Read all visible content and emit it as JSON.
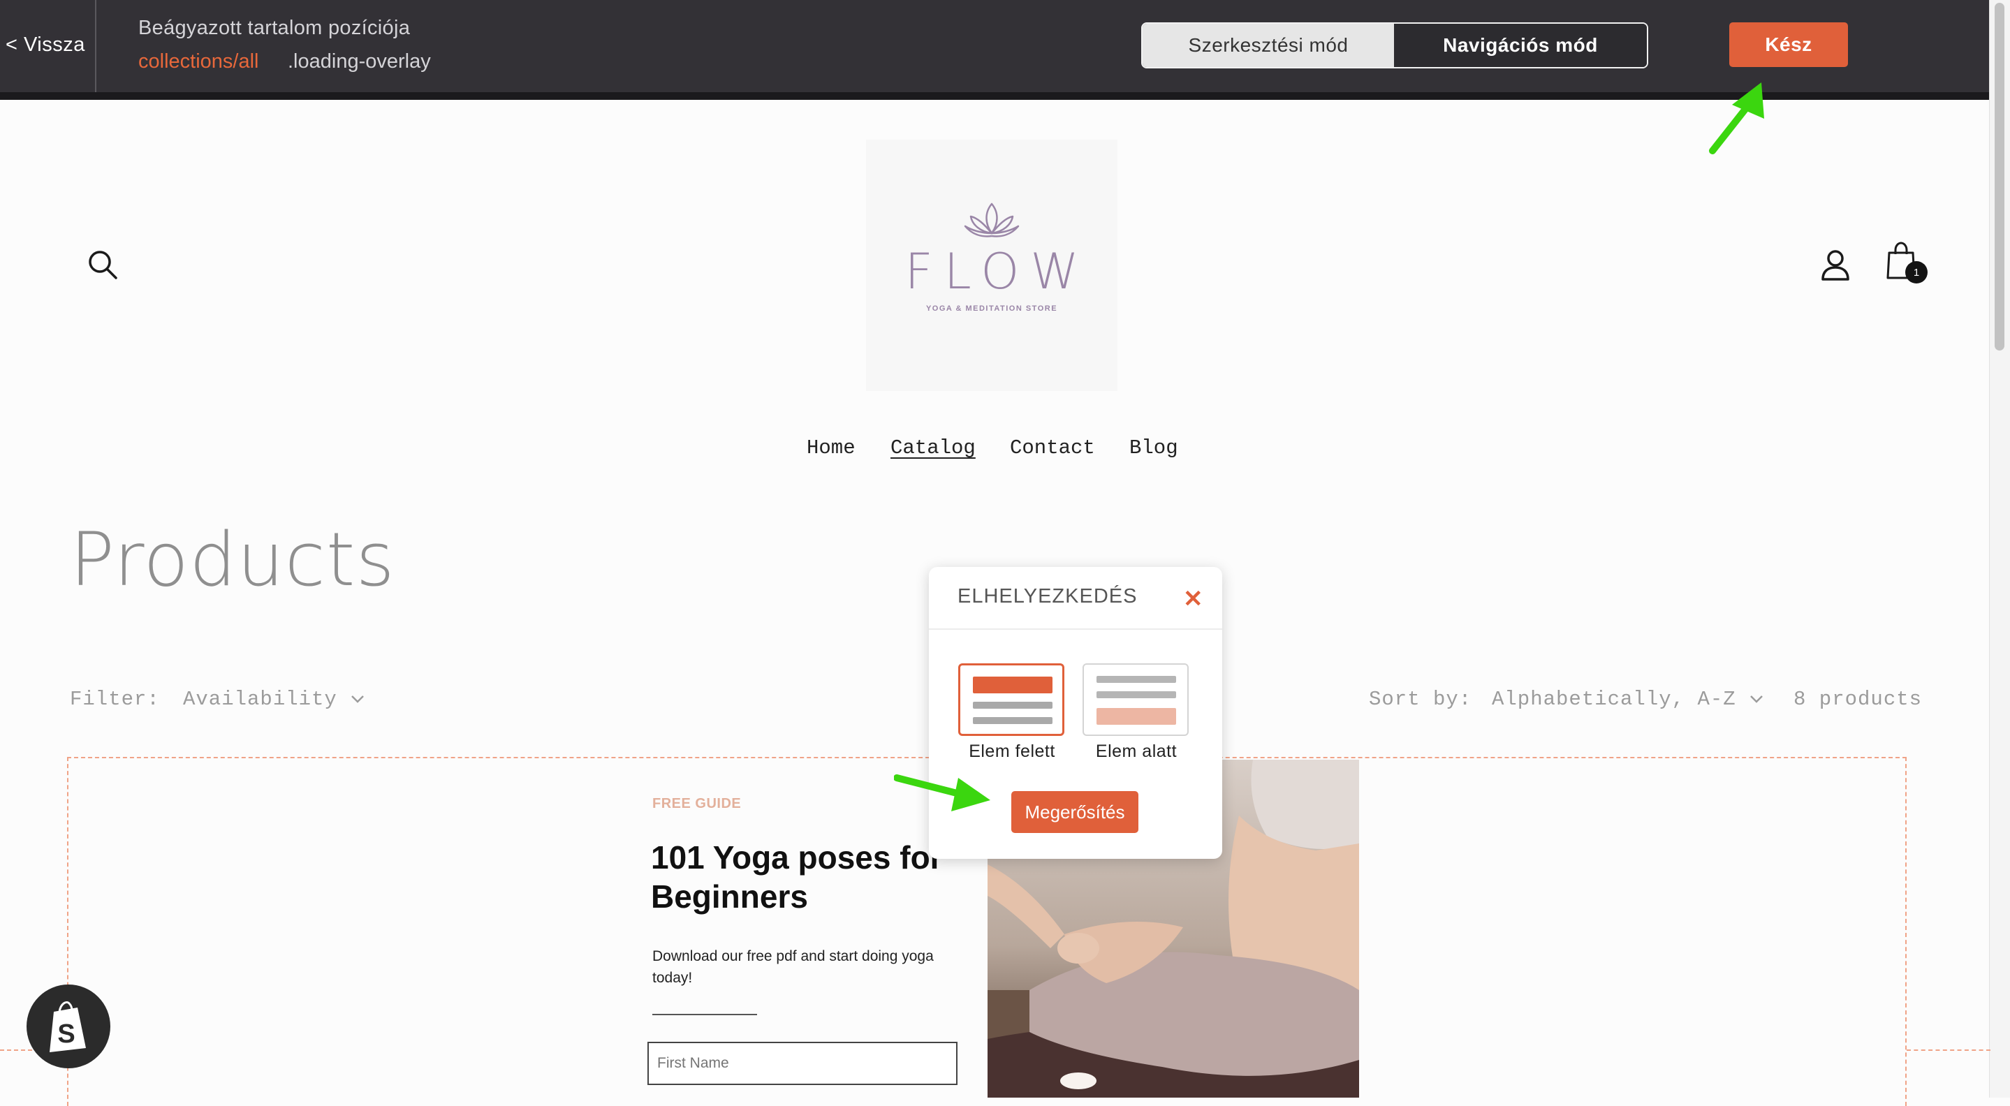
{
  "editor_bar": {
    "back_label": "< Vissza",
    "embed_title": "Beágyazott tartalom pozíciója",
    "embed_path": "collections/all",
    "embed_selector": ".loading-overlay",
    "mode_edit_label": "Szerkesztési mód",
    "mode_nav_label": "Navigációs mód",
    "done_label": "Kész"
  },
  "store_header": {
    "logo_text": "FLOW",
    "logo_tagline": "YOGA & MEDITATION STORE",
    "cart_count": "1",
    "icons": [
      "search-icon",
      "lotus-icon",
      "account-icon",
      "cart-icon"
    ]
  },
  "nav": {
    "items": [
      {
        "label": "Home"
      },
      {
        "label": "Catalog"
      },
      {
        "label": "Contact"
      },
      {
        "label": "Blog"
      }
    ],
    "active": "Catalog"
  },
  "collection": {
    "title": "Products",
    "filter_label": "Filter:",
    "filter_availability": "Availability",
    "sort_label": "Sort by:",
    "sort_value": "Alphabetically, A-Z",
    "product_count": "8 products"
  },
  "guide": {
    "eyebrow": "FREE GUIDE",
    "title": "101 Yoga poses for Beginners",
    "description": "Download our free pdf and start doing yoga today!",
    "first_name_placeholder": "First Name"
  },
  "placement_popup": {
    "title": "ELHELYEZKEDÉS",
    "option_above": "Elem felett",
    "option_below": "Elem alatt",
    "selected": "Elem felett",
    "confirm_label": "Megerősítés"
  },
  "colors": {
    "accent": "#e0603a",
    "topbar": "#333136",
    "logo": "#9a86a7",
    "embed_border": "#f0a387"
  }
}
